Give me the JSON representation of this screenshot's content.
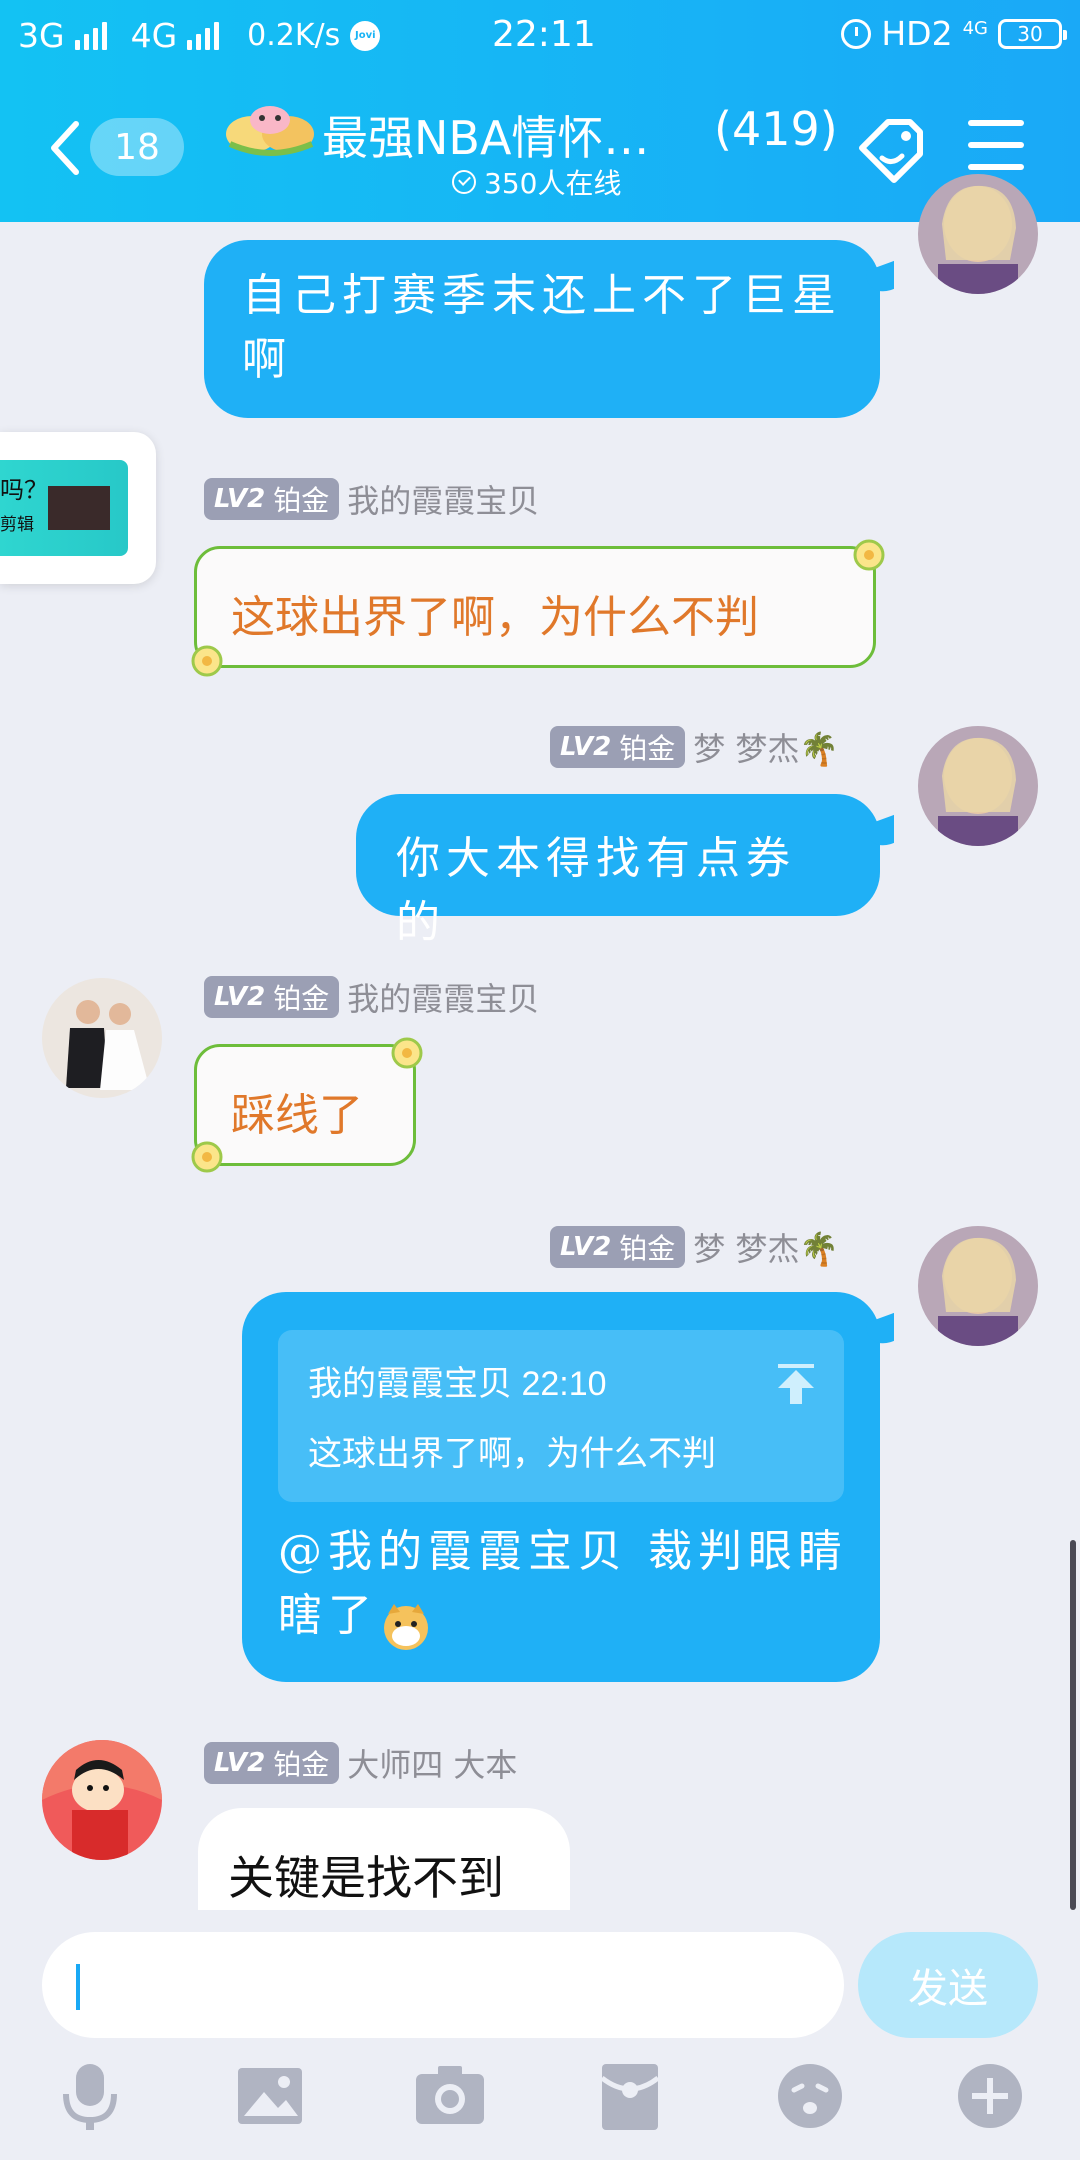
{
  "status_bar": {
    "signal1": "3G",
    "signal2": "4G",
    "speed": "0.2K/s",
    "jovi": "Jovi",
    "time": "22:11",
    "hd": "HD2",
    "net_small": "4G",
    "battery": "30"
  },
  "header": {
    "unread_count": "18",
    "title": "最强NBA情怀…",
    "member_count": "(419)",
    "online_text": "350人在线"
  },
  "messages": [
    {
      "side": "right",
      "text": "自己打赛季末还上不了巨星啊"
    },
    {
      "side": "left",
      "level": "LV2",
      "rank": "铂金",
      "sender": "我的霞霞宝贝",
      "text": "这球出界了啊，为什么不判"
    },
    {
      "side": "right",
      "level": "LV2",
      "rank": "铂金",
      "sender": "梦 梦杰🌴",
      "text": "你大本得找有点券的"
    },
    {
      "side": "left",
      "level": "LV2",
      "rank": "铂金",
      "sender": "我的霞霞宝贝",
      "text": "踩线了"
    },
    {
      "side": "right",
      "level": "LV2",
      "rank": "铂金",
      "sender": "梦 梦杰🌴",
      "quote_sender": "我的霞霞宝贝 22:10",
      "quote_text": "这球出界了啊，为什么不判",
      "text": "@我的霞霞宝贝 裁判眼睛瞎了"
    },
    {
      "side": "left",
      "level": "LV2",
      "rank": "铂金",
      "sender": "大师四  大本",
      "text": "关键是找不到"
    }
  ],
  "floating_card": {
    "line1": "吗？",
    "line2": "剪辑"
  },
  "input": {
    "send_label": "发送"
  },
  "toolbar": [
    "mic-icon",
    "image-icon",
    "camera-icon",
    "red-packet-icon",
    "emoji-icon",
    "plus-icon"
  ]
}
